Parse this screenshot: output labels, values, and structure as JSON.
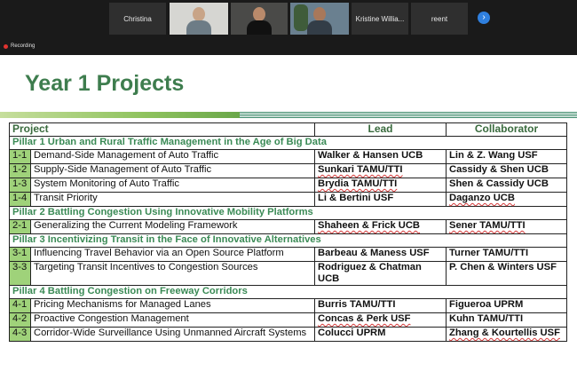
{
  "meeting": {
    "participants": [
      {
        "name": "Christina",
        "has_video": false
      },
      {
        "name": "",
        "has_video": true
      },
      {
        "name": "",
        "has_video": true
      },
      {
        "name": "",
        "has_video": true
      },
      {
        "name": "Kristine Willia...",
        "has_video": false
      },
      {
        "name": "reent",
        "has_video": false
      }
    ],
    "next_icon": "chevron-right-icon",
    "recording_label": "Recording",
    "recording_color": "#e0332f"
  },
  "slide": {
    "title": "Year 1 Projects",
    "title_color": "#3e7d4e",
    "table": {
      "headers": {
        "project": "Project",
        "lead": "Lead",
        "collaborator": "Collaborator"
      },
      "pillars": [
        {
          "title": "Pillar 1 Urban and Rural Traffic Management in the Age of Big Data",
          "rows": [
            {
              "id": "1-1",
              "project": "Demand-Side Management of Auto Traffic",
              "lead": "Walker & Hansen UCB",
              "collaborator": "Lin & Z. Wang USF"
            },
            {
              "id": "1-2",
              "project": "Supply-Side Management of Auto Traffic",
              "lead": "Sunkari TAMU/TTI",
              "collaborator": "Cassidy & Shen UCB"
            },
            {
              "id": "1-3",
              "project": "System Monitoring of Auto Traffic",
              "lead": "Brydia TAMU/TTI",
              "collaborator": "Shen & Cassidy UCB"
            },
            {
              "id": "1-4",
              "project": "Transit Priority",
              "lead": "Li & Bertini USF",
              "collaborator": "Daganzo UCB"
            }
          ]
        },
        {
          "title": "Pillar 2 Battling Congestion Using Innovative Mobility Platforms",
          "rows": [
            {
              "id": "2-1",
              "project": "Generalizing the Current Modeling Framework",
              "lead": "Shaheen & Frick UCB",
              "collaborator": "Sener TAMU/TTI"
            }
          ]
        },
        {
          "title": "Pillar 3 Incentivizing Transit in the Face of Innovative Alternatives",
          "rows": [
            {
              "id": "3-1",
              "project": "Influencing Travel Behavior via an Open Source Platform",
              "lead": "Barbeau & Maness USF",
              "collaborator": "Turner TAMU/TTI"
            },
            {
              "id": "3-3",
              "project": "Targeting Transit Incentives to Congestion Sources",
              "lead": "Rodriguez & Chatman UCB",
              "collaborator": "P. Chen & Winters USF"
            }
          ]
        },
        {
          "title": "Pillar 4 Battling Congestion on Freeway Corridors",
          "rows": [
            {
              "id": "4-1",
              "project": "Pricing Mechanisms for Managed Lanes",
              "lead": "Burris TAMU/TTI",
              "collaborator": "Figueroa UPRM"
            },
            {
              "id": "4-2",
              "project": "Proactive Congestion Management",
              "lead": "Concas & Perk USF",
              "collaborator": "Kuhn TAMU/TTI"
            },
            {
              "id": "4-3",
              "project": "Corridor-Wide Surveillance Using Unmanned Aircraft Systems",
              "lead": "Colucci UPRM",
              "collaborator": "Zhang & Kourtellis USF"
            }
          ]
        }
      ]
    }
  }
}
